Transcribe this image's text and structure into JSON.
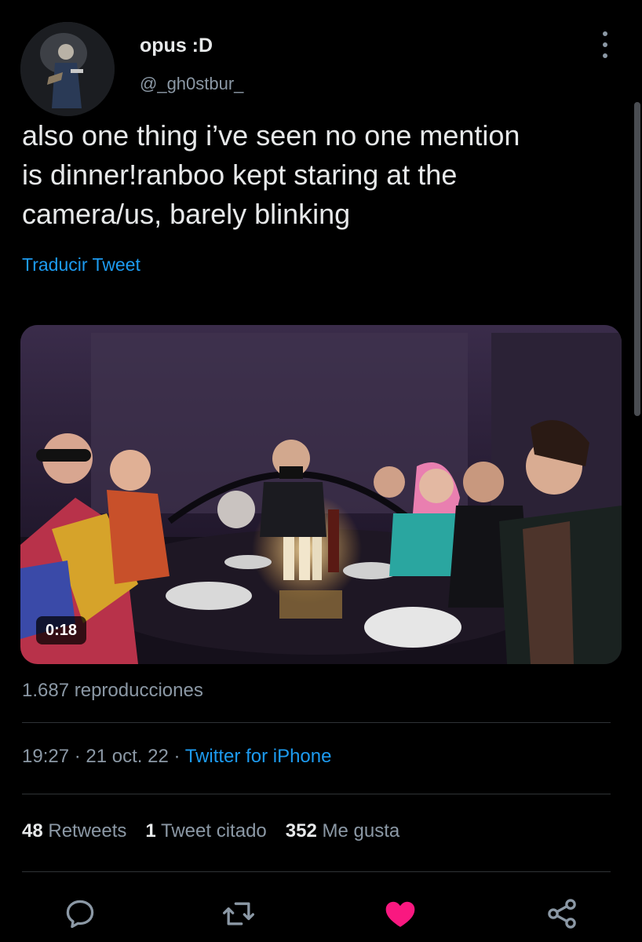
{
  "author": {
    "display_name": "opus :D",
    "handle": "@_gh0stbur_",
    "avatar_icon": "avatar-photo"
  },
  "tweet": {
    "text": "also one thing i’ve seen no one mention\nis dinner!ranboo kept staring at the\ncamera/us, barely blinking",
    "translate_label": "Traducir Tweet"
  },
  "media": {
    "type": "video",
    "duration": "0:18",
    "views_label": "1.687 reproducciones"
  },
  "meta": {
    "time": "19:27",
    "separator": " · ",
    "date": "21 oct. 22",
    "source": "Twitter for iPhone"
  },
  "stats": {
    "retweets_count": "48",
    "retweets_label": "Retweets",
    "quotes_count": "1",
    "quotes_label": "Tweet citado",
    "likes_count": "352",
    "likes_label": "Me gusta"
  },
  "actions": [
    {
      "name": "reply",
      "icon": "reply-icon"
    },
    {
      "name": "retweet",
      "icon": "retweet-icon"
    },
    {
      "name": "like",
      "icon": "heart-icon",
      "active": true
    },
    {
      "name": "share",
      "icon": "share-icon"
    }
  ],
  "colors": {
    "background": "#000000",
    "text_primary": "#e7e9ea",
    "text_secondary": "#8b98a5",
    "link": "#1d9bf0",
    "like_active": "#f91880",
    "divider": "#2f3336"
  }
}
